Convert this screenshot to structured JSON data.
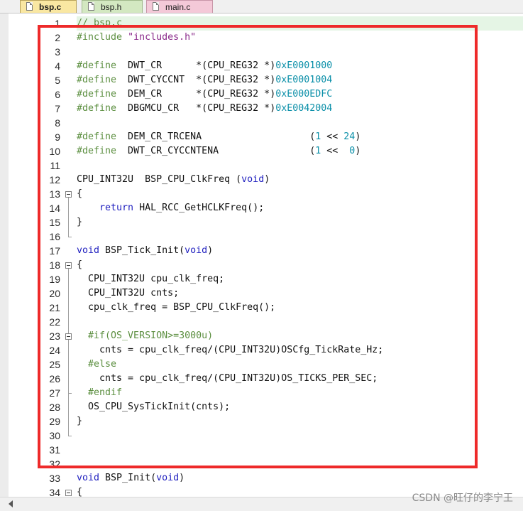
{
  "tabs": [
    {
      "label": "bsp.c",
      "active": true
    },
    {
      "label": "bsp.h",
      "active": false
    },
    {
      "label": "main.c",
      "active": false
    }
  ],
  "watermark": "CSDN @旺仔的李宁王",
  "colors": {
    "highlight_frame": "#ee2a2a",
    "keyword": "#1f1fbf",
    "preprocessor": "#5c8f40",
    "string": "#8a2a8a",
    "number": "#0a8fa8"
  },
  "editor": {
    "lines": [
      {
        "n": "1",
        "parts": [
          [
            "pp",
            "// bsp.c"
          ]
        ]
      },
      {
        "n": "2",
        "parts": [
          [
            "pp",
            "#include "
          ],
          [
            "str",
            "\"includes.h\""
          ]
        ]
      },
      {
        "n": "3",
        "parts": []
      },
      {
        "n": "4",
        "parts": [
          [
            "pp",
            "#define"
          ],
          [
            "id",
            "  DWT_CR      *(CPU_REG32 *)"
          ],
          [
            "num",
            "0xE0001000"
          ]
        ]
      },
      {
        "n": "5",
        "parts": [
          [
            "pp",
            "#define"
          ],
          [
            "id",
            "  DWT_CYCCNT  *(CPU_REG32 *)"
          ],
          [
            "num",
            "0xE0001004"
          ]
        ]
      },
      {
        "n": "6",
        "parts": [
          [
            "pp",
            "#define"
          ],
          [
            "id",
            "  DEM_CR      *(CPU_REG32 *)"
          ],
          [
            "num",
            "0xE000EDFC"
          ]
        ]
      },
      {
        "n": "7",
        "parts": [
          [
            "pp",
            "#define"
          ],
          [
            "id",
            "  DBGMCU_CR   *(CPU_REG32 *)"
          ],
          [
            "num",
            "0xE0042004"
          ]
        ]
      },
      {
        "n": "8",
        "parts": []
      },
      {
        "n": "9",
        "parts": [
          [
            "pp",
            "#define"
          ],
          [
            "id",
            "  DEM_CR_TRCENA                   ("
          ],
          [
            "num",
            "1"
          ],
          [
            "id",
            " << "
          ],
          [
            "num",
            "24"
          ],
          [
            "id",
            ")"
          ]
        ]
      },
      {
        "n": "10",
        "parts": [
          [
            "pp",
            "#define"
          ],
          [
            "id",
            "  DWT_CR_CYCCNTENA                ("
          ],
          [
            "num",
            "1"
          ],
          [
            "id",
            " <<  "
          ],
          [
            "num",
            "0"
          ],
          [
            "id",
            ")"
          ]
        ]
      },
      {
        "n": "11",
        "parts": []
      },
      {
        "n": "12",
        "parts": [
          [
            "id",
            "CPU_INT32U  BSP_CPU_ClkFreq ("
          ],
          [
            "kw",
            "void"
          ],
          [
            "id",
            ")"
          ]
        ]
      },
      {
        "n": "13",
        "parts": [
          [
            "id",
            "{"
          ]
        ]
      },
      {
        "n": "14",
        "parts": [
          [
            "id",
            "    "
          ],
          [
            "kw",
            "return"
          ],
          [
            "id",
            " HAL_RCC_GetHCLKFreq();"
          ]
        ]
      },
      {
        "n": "15",
        "parts": [
          [
            "id",
            "}"
          ]
        ]
      },
      {
        "n": "16",
        "parts": []
      },
      {
        "n": "17",
        "parts": [
          [
            "kw",
            "void"
          ],
          [
            "id",
            " BSP_Tick_Init("
          ],
          [
            "kw",
            "void"
          ],
          [
            "id",
            ")"
          ]
        ]
      },
      {
        "n": "18",
        "parts": [
          [
            "id",
            "{"
          ]
        ]
      },
      {
        "n": "19",
        "parts": [
          [
            "id",
            "  CPU_INT32U cpu_clk_freq;"
          ]
        ]
      },
      {
        "n": "20",
        "parts": [
          [
            "id",
            "  CPU_INT32U cnts;"
          ]
        ]
      },
      {
        "n": "21",
        "parts": [
          [
            "id",
            "  cpu_clk_freq = BSP_CPU_ClkFreq();"
          ]
        ]
      },
      {
        "n": "22",
        "parts": []
      },
      {
        "n": "23",
        "parts": [
          [
            "id",
            "  "
          ],
          [
            "pp",
            "#if(OS_VERSION>=3000u)"
          ]
        ]
      },
      {
        "n": "24",
        "parts": [
          [
            "id",
            "    cnts = cpu_clk_freq/(CPU_INT32U)OSCfg_TickRate_Hz;"
          ]
        ]
      },
      {
        "n": "25",
        "parts": [
          [
            "id",
            "  "
          ],
          [
            "pp",
            "#else"
          ]
        ]
      },
      {
        "n": "26",
        "parts": [
          [
            "id",
            "    cnts = cpu_clk_freq/(CPU_INT32U)OS_TICKS_PER_SEC;"
          ]
        ]
      },
      {
        "n": "27",
        "parts": [
          [
            "id",
            "  "
          ],
          [
            "pp",
            "#endif"
          ]
        ]
      },
      {
        "n": "28",
        "parts": [
          [
            "id",
            "  OS_CPU_SysTickInit(cnts);"
          ]
        ]
      },
      {
        "n": "29",
        "parts": [
          [
            "id",
            "}"
          ]
        ]
      },
      {
        "n": "30",
        "parts": []
      },
      {
        "n": "31",
        "parts": []
      },
      {
        "n": "32",
        "parts": []
      },
      {
        "n": "33",
        "parts": [
          [
            "kw",
            "void"
          ],
          [
            "id",
            " BSP_Init("
          ],
          [
            "kw",
            "void"
          ],
          [
            "id",
            ")"
          ]
        ]
      },
      {
        "n": "34",
        "parts": [
          [
            "id",
            "{"
          ]
        ]
      }
    ]
  }
}
